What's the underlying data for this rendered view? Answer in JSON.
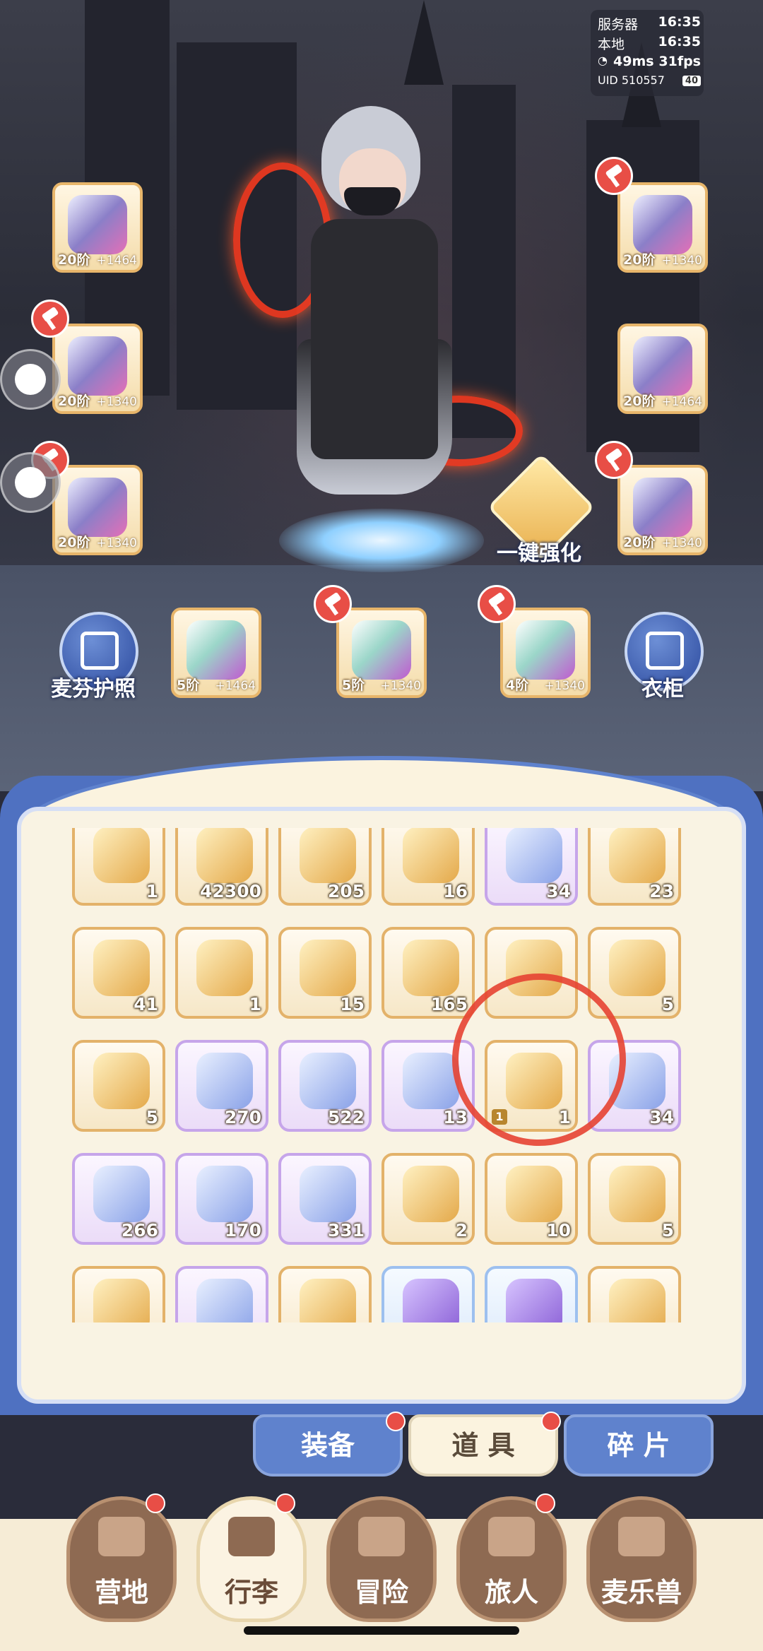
{
  "status": {
    "server_label": "服务器",
    "server_time": "16:35",
    "local_label": "本地",
    "local_time": "16:35",
    "ping": "49ms",
    "fps": "31fps",
    "uid_label": "UID 510557",
    "battery": "40"
  },
  "equipment": {
    "left": [
      {
        "level": "20阶",
        "bonus": "+1464",
        "icon": "bow-icon"
      },
      {
        "level": "20阶",
        "bonus": "+1340",
        "icon": "armor-icon"
      },
      {
        "level": "20阶",
        "bonus": "+1340",
        "icon": "belt-icon"
      }
    ],
    "right": [
      {
        "level": "20阶",
        "bonus": "+1340",
        "icon": "helmet-icon"
      },
      {
        "level": "20阶",
        "bonus": "+1464",
        "icon": "gauntlet-icon"
      },
      {
        "level": "20阶",
        "bonus": "+1340",
        "icon": "boots-icon"
      }
    ],
    "accessories": [
      {
        "level": "5阶",
        "bonus": "+1464",
        "icon": "ring-icon"
      },
      {
        "level": "5阶",
        "bonus": "+1340",
        "icon": "necklace-icon"
      },
      {
        "level": "4阶",
        "bonus": "+1340",
        "icon": "earring-icon"
      }
    ]
  },
  "actions": {
    "passport": "麦芬护照",
    "wardrobe": "衣柜",
    "one_click_upgrade": "一键强化"
  },
  "inventory": {
    "rows": [
      [
        {
          "count": "1",
          "icon": "treasure-chest-icon",
          "rarity": "gold"
        },
        {
          "count": "42300",
          "icon": "wood-planks-icon",
          "rarity": "gold"
        },
        {
          "count": "205",
          "icon": "soup-bowl-icon",
          "rarity": "gold"
        },
        {
          "count": "16",
          "icon": "coins-pile-icon",
          "rarity": "gold"
        },
        {
          "count": "34",
          "icon": "heart-plush-icon",
          "rarity": "purple"
        },
        {
          "count": "23",
          "icon": "ink-bottle-icon",
          "rarity": "gold"
        }
      ],
      [
        {
          "count": "41",
          "icon": "ink-quill-icon",
          "rarity": "gold"
        },
        {
          "count": "1",
          "icon": "star-scroll-icon",
          "rarity": "gold"
        },
        {
          "count": "15",
          "icon": "iron-icon",
          "rarity": "gold"
        },
        {
          "count": "165",
          "icon": "spoon-icon",
          "rarity": "gold"
        },
        {
          "count": "",
          "icon": "key-icon",
          "rarity": "gold"
        },
        {
          "count": "5",
          "icon": "sandwich-icon",
          "rarity": "gold"
        }
      ],
      [
        {
          "count": "5",
          "icon": "cake-icon",
          "rarity": "gold"
        },
        {
          "count": "270",
          "icon": "sky-card-icon",
          "rarity": "purple"
        },
        {
          "count": "522",
          "icon": "moon-card-icon",
          "rarity": "purple"
        },
        {
          "count": "13",
          "icon": "wing-coin-icon",
          "rarity": "purple"
        },
        {
          "count": "1",
          "icon": "castle-token-icon",
          "rarity": "gold",
          "badge": "1"
        },
        {
          "count": "34",
          "icon": "wing-coin-icon",
          "rarity": "purple"
        }
      ],
      [
        {
          "count": "266",
          "icon": "moon-coin-icon",
          "rarity": "purple"
        },
        {
          "count": "170",
          "icon": "smile-coin-icon",
          "rarity": "purple"
        },
        {
          "count": "331",
          "icon": "swirl-coin-icon",
          "rarity": "purple"
        },
        {
          "count": "2",
          "icon": "ticket-icon",
          "rarity": "gold"
        },
        {
          "count": "10",
          "icon": "paper-plane-icon",
          "rarity": "gold"
        },
        {
          "count": "5",
          "icon": "prism-gem-icon",
          "rarity": "gold"
        }
      ],
      [
        {
          "count": "",
          "icon": "star-icon",
          "rarity": "gold"
        },
        {
          "count": "",
          "icon": "dolphin-icon",
          "rarity": "purple"
        },
        {
          "count": "",
          "icon": "water-bottle-icon",
          "rarity": "gold"
        },
        {
          "count": "",
          "icon": "purple-scroll-icon",
          "rarity": "blue"
        },
        {
          "count": "",
          "icon": "gold-scroll-icon",
          "rarity": "blue"
        },
        {
          "count": "",
          "icon": "bell-icon",
          "rarity": "gold"
        }
      ]
    ]
  },
  "subtabs": [
    {
      "label": "装备",
      "active": false,
      "dot": true
    },
    {
      "label": "道 具",
      "active": true,
      "dot": true
    },
    {
      "label": "碎 片",
      "active": false,
      "dot": false
    }
  ],
  "nav": [
    {
      "label": "营地",
      "active": false,
      "dot": true,
      "icon": "castle-icon"
    },
    {
      "label": "行李",
      "active": true,
      "dot": true,
      "icon": "luggage-icon"
    },
    {
      "label": "冒险",
      "active": false,
      "dot": false,
      "icon": "crossed-swords-icon"
    },
    {
      "label": "旅人",
      "active": false,
      "dot": true,
      "icon": "traveler-icon"
    },
    {
      "label": "麦乐兽",
      "active": false,
      "dot": false,
      "icon": "cat-pet-icon"
    }
  ],
  "colors": {
    "gold_border": "#e3b26a",
    "purple_border": "#c6a5ea",
    "blue_border": "#9dc0ef",
    "panel_blue": "#4f71c1",
    "annotation_red": "#e64332"
  }
}
